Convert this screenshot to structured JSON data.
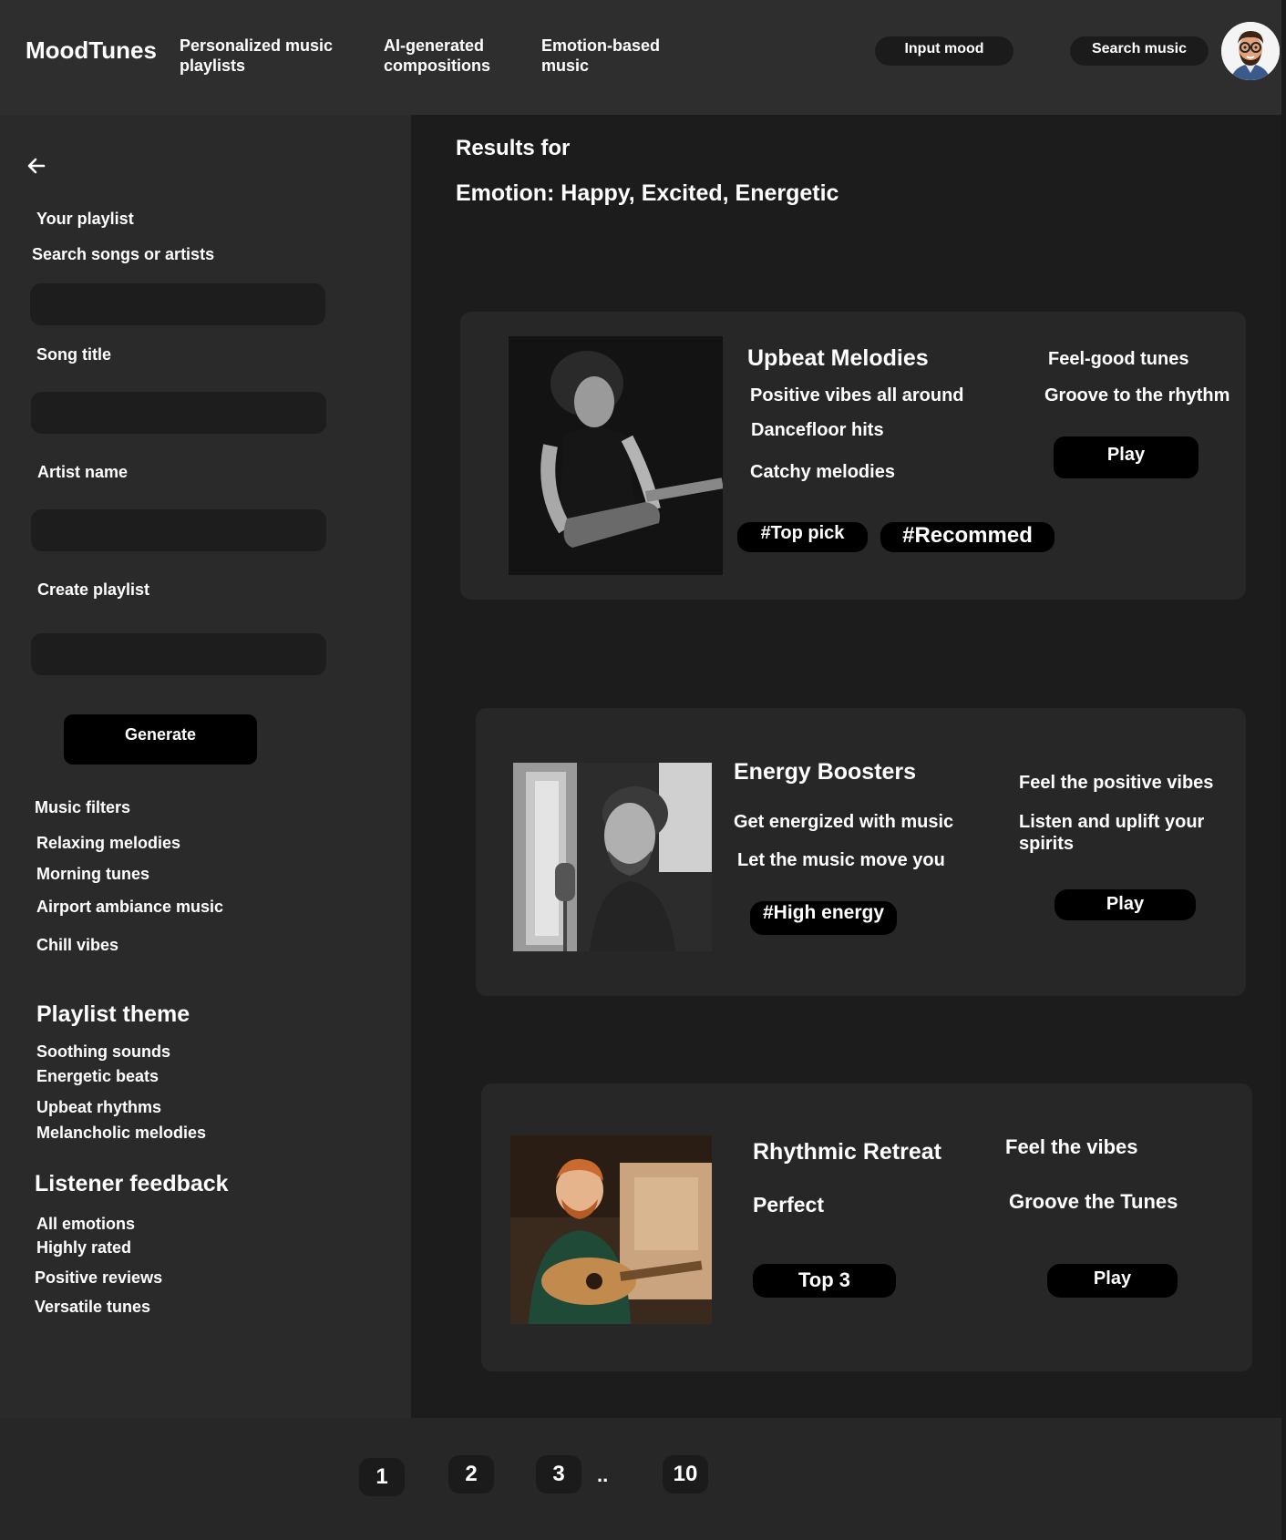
{
  "header": {
    "logo": "MoodTunes",
    "nav": [
      {
        "line1": "Personalized music",
        "line2": "playlists"
      },
      {
        "line1": "AI-generated",
        "line2": "compositions"
      },
      {
        "line1": "Emotion-based",
        "line2": "music"
      }
    ],
    "input_mood_label": "Input mood",
    "search_music_label": "Search music"
  },
  "sidebar": {
    "back_icon": "arrow-left-icon",
    "your_playlist": "Your playlist",
    "search_label": "Search songs or artists",
    "song_title_label": "Song title",
    "artist_name_label": "Artist name",
    "create_playlist_label": "Create playlist",
    "generate_label": "Generate",
    "filters_title": "Music filters",
    "filters": [
      "Relaxing melodies",
      "Morning tunes",
      "Airport ambiance music",
      "Chill vibes"
    ],
    "theme_title": "Playlist theme",
    "themes": [
      "Soothing sounds",
      "Energetic beats",
      "Upbeat rhythms",
      "Melancholic melodies"
    ],
    "feedback_title": "Listener feedback",
    "feedback": [
      "All emotions",
      "Highly rated",
      "Positive reviews",
      "Versatile tunes"
    ]
  },
  "main": {
    "results_for": "Results for",
    "emotion": "Emotion: Happy, Excited, Energetic",
    "cards": [
      {
        "title": "Upbeat Melodies",
        "lines": [
          "Positive vibes all around",
          "Dancefloor hits",
          "Catchy melodies"
        ],
        "right": [
          "Feel-good tunes",
          "Groove to the rhythm"
        ],
        "tags": [
          "#Top pick",
          "#Recommed"
        ],
        "play": "Play"
      },
      {
        "title": "Energy Boosters",
        "lines": [
          "Get energized with music",
          "Let the music move you"
        ],
        "right": [
          "Feel the positive vibes",
          "Listen and uplift your spirits"
        ],
        "tags": [
          "#High energy"
        ],
        "play": "Play"
      },
      {
        "title": "Rhythmic Retreat",
        "lines": [
          "Perfect"
        ],
        "right": [
          "Feel the vibes",
          "Groove the Tunes"
        ],
        "tags": [
          "Top 3"
        ],
        "play": "Play"
      }
    ]
  },
  "pagination": {
    "pages": [
      "1",
      "2",
      "3",
      "10"
    ],
    "ellipsis": ".."
  }
}
